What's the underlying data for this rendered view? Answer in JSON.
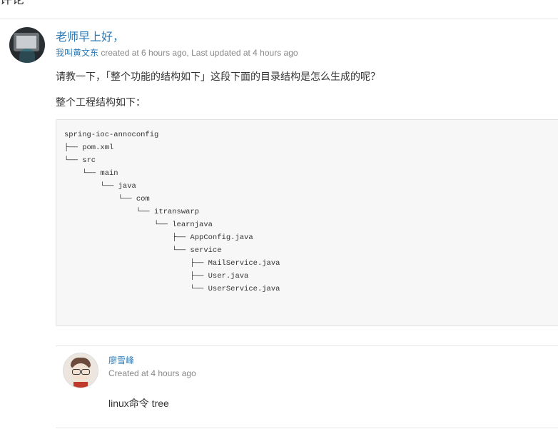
{
  "section": {
    "title": "评论"
  },
  "comment": {
    "title": "老师早上好，",
    "author": "我叫黄文东",
    "meta_suffix": " created at 6 hours ago, Last updated at 4 hours ago",
    "question": "请教一下，「整个功能的结构如下」这段下面的目录结构是怎么生成的呢？",
    "intro": "整个工程结构如下：",
    "code": "spring-ioc-annoconfig\n├── pom.xml\n└── src\n    └── main\n        └── java\n            └── com\n                └── itranswarp\n                    └── learnjava\n                        ├── AppConfig.java\n                        └── service\n                            ├── MailService.java\n                            ├── User.java\n                            └── UserService.java"
  },
  "reply": {
    "author": "廖雪峰",
    "meta": "Created at 4 hours ago",
    "text": "linux命令 tree"
  }
}
